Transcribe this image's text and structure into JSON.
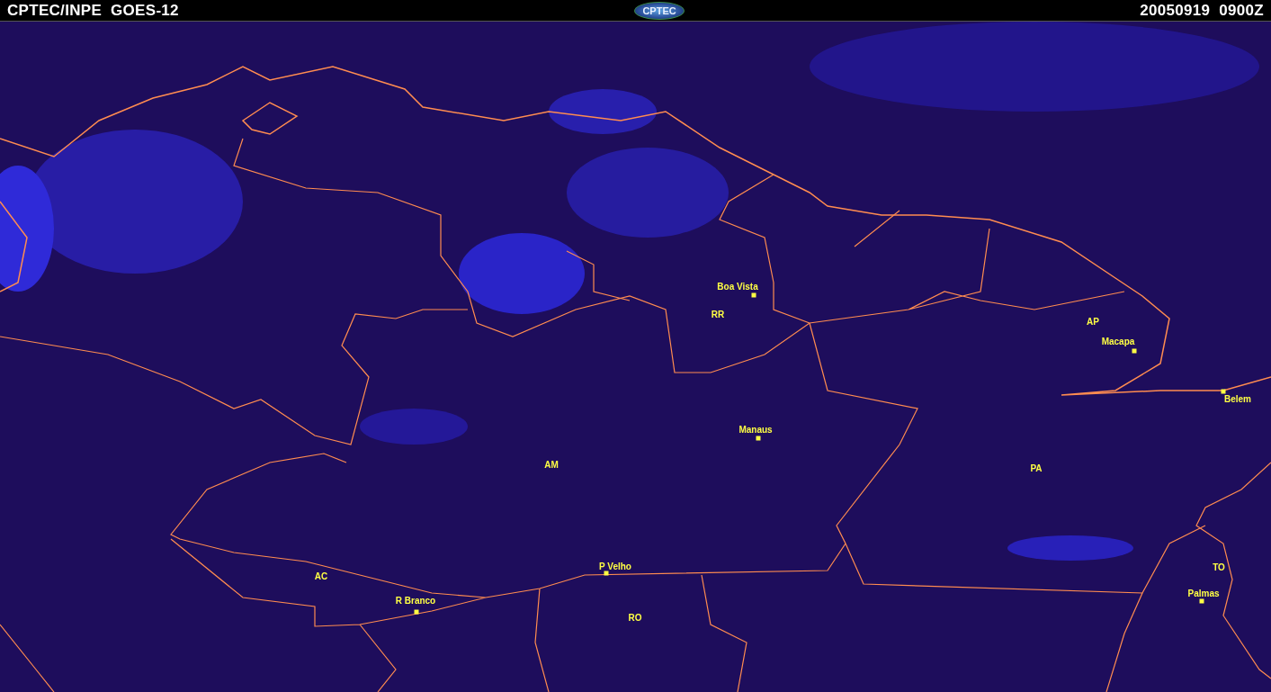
{
  "header": {
    "source": "CPTEC/INPE  GOES-12",
    "logo": "CPTEC",
    "timestamp": "20050919  0900Z"
  },
  "places": [
    {
      "kind": "city",
      "label": "Boa Vista"
    },
    {
      "kind": "state",
      "label": "RR"
    },
    {
      "kind": "state",
      "label": "AP"
    },
    {
      "kind": "city",
      "label": "Macapa"
    },
    {
      "kind": "city",
      "label": "Belem"
    },
    {
      "kind": "city",
      "label": "Manaus"
    },
    {
      "kind": "state",
      "label": "AM"
    },
    {
      "kind": "state",
      "label": "PA"
    },
    {
      "kind": "state",
      "label": "AC"
    },
    {
      "kind": "city",
      "label": "R Branco"
    },
    {
      "kind": "city",
      "label": "P Velho"
    },
    {
      "kind": "state",
      "label": "RO"
    },
    {
      "kind": "state",
      "label": "TO"
    },
    {
      "kind": "city",
      "label": "Palmas"
    }
  ]
}
